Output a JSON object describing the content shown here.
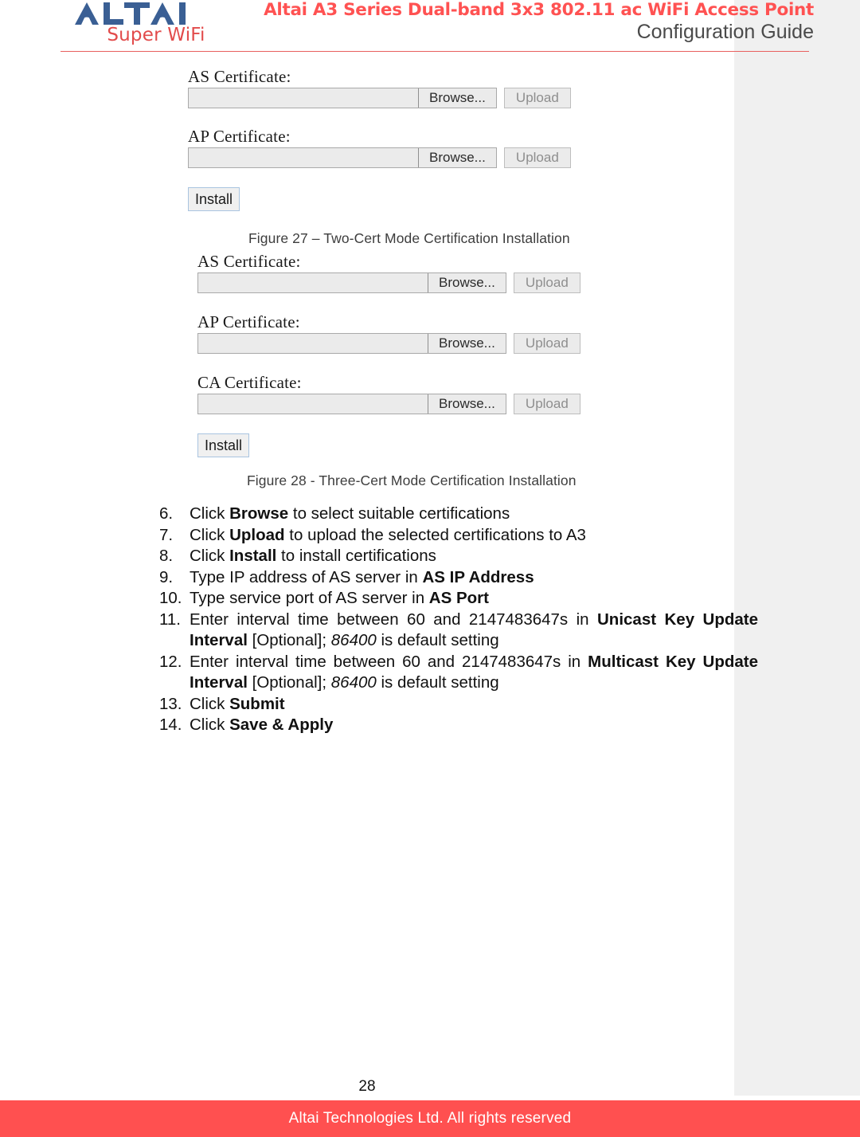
{
  "header": {
    "logo_name": "ALTAI",
    "logo_tagline": "Super WiFi",
    "title_main": "Altai A3 Series Dual-band 3x3 802.11 ac WiFi Access Point",
    "title_sub": "Configuration Guide",
    "accent_color": "#ff5252",
    "rule_color": "#e8605f"
  },
  "figures": [
    {
      "caption": "Figure 27 – Two-Cert Mode Certification Installation",
      "rows": [
        {
          "label": "AS Certificate:",
          "value": "",
          "browse_label": "Browse...",
          "upload_label": "Upload"
        },
        {
          "label": "AP Certificate:",
          "value": "",
          "browse_label": "Browse...",
          "upload_label": "Upload"
        }
      ],
      "install_label": "Install"
    },
    {
      "caption": "Figure 28 - Three-Cert Mode Certification Installation",
      "rows": [
        {
          "label": "AS Certificate:",
          "value": "",
          "browse_label": "Browse...",
          "upload_label": "Upload"
        },
        {
          "label": "AP Certificate:",
          "value": "",
          "browse_label": "Browse...",
          "upload_label": "Upload"
        },
        {
          "label": "CA Certificate:",
          "value": "",
          "browse_label": "Browse...",
          "upload_label": "Upload"
        }
      ],
      "install_label": "Install"
    }
  ],
  "steps": [
    {
      "num": "6.",
      "html": "Click <b>Browse</b> to select suitable certifications",
      "justify": false
    },
    {
      "num": "7.",
      "html": "Click <b>Upload</b> to upload the selected certifications to A3",
      "justify": false
    },
    {
      "num": "8.",
      "html": "Click <b>Install</b> to install certifications",
      "justify": false
    },
    {
      "num": "9.",
      "html": "Type IP address of AS server in <b>AS IP Address</b>",
      "justify": false
    },
    {
      "num": "10.",
      "html": "Type service port of AS server in <b>AS Port</b>",
      "justify": false
    },
    {
      "num": "11.",
      "html": "Enter interval time between 60 and 2147483647s in <b>Unicast Key Update Interval</b> [Optional]; <i>86400</i> is default setting",
      "justify": true
    },
    {
      "num": "12.",
      "html": "Enter interval time between 60 and 2147483647s in <b>Multicast Key Update Interval</b> [Optional]; <i>86400</i> is default setting",
      "justify": true
    },
    {
      "num": "13.",
      "html": "Click <b>Submit</b>",
      "justify": false
    },
    {
      "num": "14.",
      "html": "Click <b>Save &amp; Apply</b>",
      "justify": false
    }
  ],
  "footer": {
    "page_number": "28",
    "copyright": "Altai Technologies Ltd. All rights reserved",
    "bar_color": "#ff5050"
  }
}
